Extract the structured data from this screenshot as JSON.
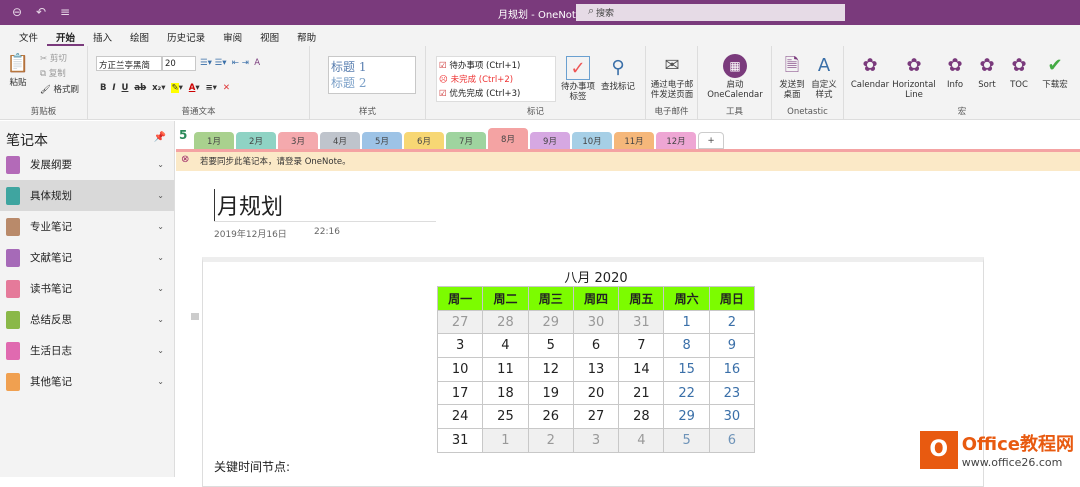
{
  "titlebar": {
    "title": "月规划 - OneNote",
    "search_placeholder": "搜索"
  },
  "menu": [
    "文件",
    "开始",
    "插入",
    "绘图",
    "历史记录",
    "审阅",
    "视图",
    "帮助"
  ],
  "ribbon": {
    "clipboard": {
      "paste": "粘贴",
      "cut": "剪切",
      "copy": "复制",
      "format_painter": "格式刷",
      "label": "剪贴板"
    },
    "text": {
      "font": "方正兰亭黑简",
      "size": "20",
      "label": "普通文本"
    },
    "styles": {
      "h1": "标题 1",
      "h2": "标题 2",
      "label": "样式"
    },
    "tags": {
      "items": [
        "待办事项 (Ctrl+1)",
        "未完成 (Ctrl+2)",
        "优先完成 (Ctrl+3)"
      ],
      "todo_tag": "待办事项标签",
      "find_tags": "查找标记",
      "label": "标记"
    },
    "email": {
      "send": "通过电子邮件发送页面",
      "label": "电子邮件"
    },
    "tools": {
      "onecalendar": "启动 OneCalendar",
      "label": "工具"
    },
    "onetastic": {
      "send_desktop": "发送到桌面",
      "custom_style": "自定义样式",
      "label": "Onetastic"
    },
    "macros": {
      "items": [
        "Calendar",
        "Horizontal Line",
        "Info",
        "Sort",
        "TOC",
        "下载宏"
      ],
      "label": "宏"
    }
  },
  "sidebar": {
    "title": "笔记本",
    "notebooks": [
      {
        "name": "发展纲要",
        "color": "#b36ab8"
      },
      {
        "name": "具体规划",
        "color": "#3fa5a0"
      },
      {
        "name": "专业笔记",
        "color": "#b98a6a"
      },
      {
        "name": "文献笔记",
        "color": "#a66ab8"
      },
      {
        "name": "读书笔记",
        "color": "#e57a9a"
      },
      {
        "name": "总结反思",
        "color": "#8ab848"
      },
      {
        "name": "生活日志",
        "color": "#e06ab0"
      },
      {
        "name": "其他笔记",
        "color": "#f0a050"
      }
    ]
  },
  "tabs": [
    {
      "label": "1月",
      "color": "#a9d18e"
    },
    {
      "label": "2月",
      "color": "#8fd3c4"
    },
    {
      "label": "3月",
      "color": "#f4a9ad"
    },
    {
      "label": "4月",
      "color": "#bfc4cc"
    },
    {
      "label": "5月",
      "color": "#9dc3e6"
    },
    {
      "label": "6月",
      "color": "#f7d774"
    },
    {
      "label": "7月",
      "color": "#9fd49f"
    },
    {
      "label": "8月",
      "color": "#f4a3a3"
    },
    {
      "label": "9月",
      "color": "#d6a8e2"
    },
    {
      "label": "10月",
      "color": "#a6cfe6"
    },
    {
      "label": "11月",
      "color": "#f5b77a"
    },
    {
      "label": "12月",
      "color": "#eea6d4"
    },
    {
      "label": "+",
      "color": "#ffffff"
    }
  ],
  "notice": "若要同步此笔记本，请登录 OneNote。",
  "page": {
    "title": "月规划",
    "date": "2019年12月16日",
    "time": "22:16",
    "key_dates": "关键时间节点:"
  },
  "calendar": {
    "title": "八月 2020",
    "headers": [
      "周一",
      "周二",
      "周三",
      "周四",
      "周五",
      "周六",
      "周日"
    ],
    "weeks": [
      [
        "27",
        "28",
        "29",
        "30",
        "31",
        "1",
        "2"
      ],
      [
        "3",
        "4",
        "5",
        "6",
        "7",
        "8",
        "9"
      ],
      [
        "10",
        "11",
        "12",
        "13",
        "14",
        "15",
        "16"
      ],
      [
        "17",
        "18",
        "19",
        "20",
        "21",
        "22",
        "23"
      ],
      [
        "24",
        "25",
        "26",
        "27",
        "28",
        "29",
        "30"
      ],
      [
        "31",
        "1",
        "2",
        "3",
        "4",
        "5",
        "6"
      ]
    ]
  },
  "watermark": {
    "brand": "Office教程网",
    "url": "www.office26.com"
  }
}
